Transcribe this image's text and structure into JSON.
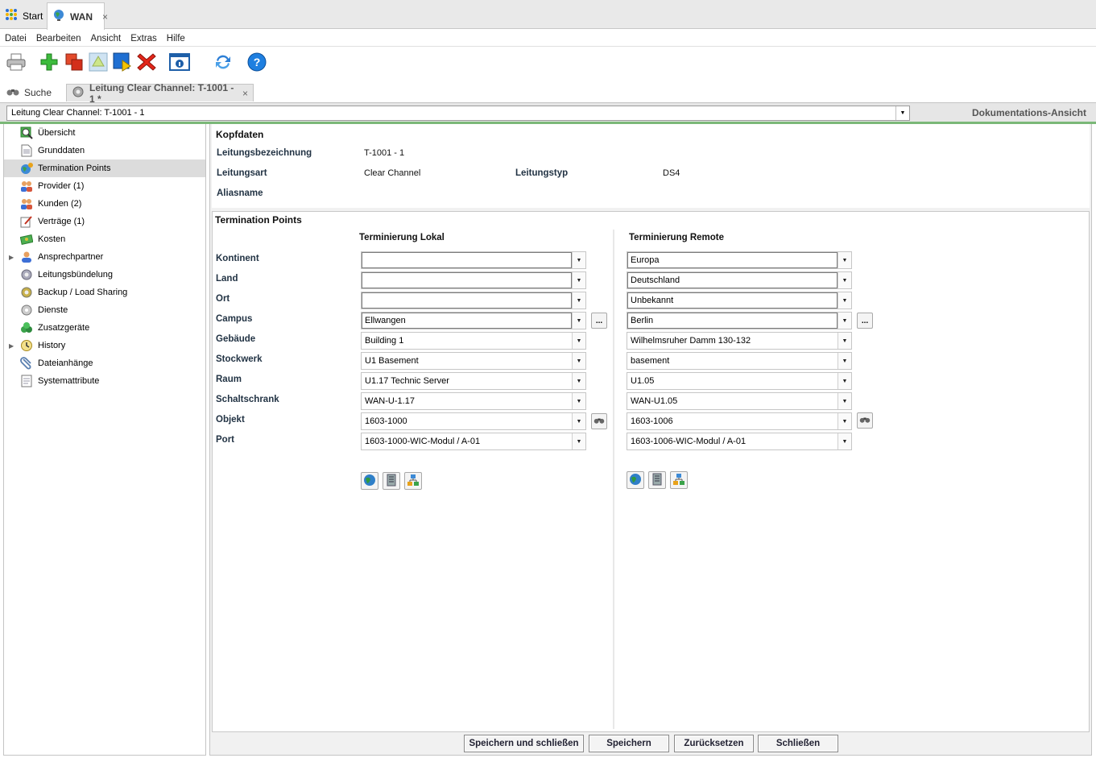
{
  "app_tabs": [
    {
      "label": "Start"
    },
    {
      "label": "WAN",
      "close": "×"
    }
  ],
  "menu": [
    "Datei",
    "Bearbeiten",
    "Ansicht",
    "Extras",
    "Hilfe"
  ],
  "toolbar": [
    {
      "icon": "printer-icon"
    },
    {
      "icon": "add-icon"
    },
    {
      "icon": "copy-icon"
    },
    {
      "icon": "move-up-icon"
    },
    {
      "icon": "export-icon"
    },
    {
      "icon": "delete-icon"
    },
    {
      "icon": "info-icon"
    },
    {
      "icon": "refresh-icon"
    },
    {
      "icon": "help-icon"
    }
  ],
  "doc_tabs": {
    "search_label": "Suche",
    "active_label": "Leitung Clear Channel: T-1001 - 1 *",
    "close": "×"
  },
  "header": {
    "combo_value": "Leitung Clear Channel: T-1001 - 1",
    "view_label": "Dokumentations-Ansicht"
  },
  "sidebar": {
    "items": [
      {
        "label": "Übersicht",
        "icon": "overview-icon"
      },
      {
        "label": "Grunddaten",
        "icon": "document-icon"
      },
      {
        "label": "Termination Points",
        "icon": "termination-icon",
        "selected": true
      },
      {
        "label": "Provider (1)",
        "icon": "people-icon"
      },
      {
        "label": "Kunden (2)",
        "icon": "people-icon"
      },
      {
        "label": "Verträge (1)",
        "icon": "contract-icon"
      },
      {
        "label": "Kosten",
        "icon": "money-icon"
      },
      {
        "label": "Ansprechpartner",
        "icon": "person-icon",
        "expandable": true
      },
      {
        "label": "Leitungsbündelung",
        "icon": "gear-icon"
      },
      {
        "label": "Backup / Load Sharing",
        "icon": "gear-icon"
      },
      {
        "label": "Dienste",
        "icon": "service-icon"
      },
      {
        "label": "Zusatzgeräte",
        "icon": "devices-icon"
      },
      {
        "label": "History",
        "icon": "history-icon",
        "expandable": true
      },
      {
        "label": "Dateianhänge",
        "icon": "attachment-icon"
      },
      {
        "label": "Systemattribute",
        "icon": "attributes-icon"
      }
    ]
  },
  "kopfdaten": {
    "title": "Kopfdaten",
    "leitungsbezeichnung_label": "Leitungsbezeichnung",
    "leitungsbezeichnung_value": "T-1001 - 1",
    "leitungsart_label": "Leitungsart",
    "leitungsart_value": "Clear Channel",
    "leitungstyp_label": "Leitungstyp",
    "leitungstyp_value": "DS4",
    "aliasname_label": "Aliasname"
  },
  "termination": {
    "title": "Termination Points",
    "local_header": "Terminierung Lokal",
    "remote_header": "Terminierung Remote",
    "browse_label": "...",
    "fields": [
      {
        "label": "Kontinent",
        "local": "",
        "remote": "Europa"
      },
      {
        "label": "Land",
        "local": "",
        "remote": "Deutschland"
      },
      {
        "label": "Ort",
        "local": "",
        "remote": "Unbekannt"
      },
      {
        "label": "Campus",
        "local": "Ellwangen",
        "remote": "Berlin"
      },
      {
        "label": "Gebäude",
        "local": "Building 1",
        "remote": "Wilhelmsruher Damm 130-132"
      },
      {
        "label": "Stockwerk",
        "local": "U1 Basement",
        "remote": "basement"
      },
      {
        "label": "Raum",
        "local": "U1.17 Technic Server",
        "remote": "U1.05"
      },
      {
        "label": "Schaltschrank",
        "local": "WAN-U-1.17",
        "remote": "WAN-U1.05"
      },
      {
        "label": "Objekt",
        "local": "1603-1000",
        "remote": "1603-1006"
      },
      {
        "label": "Port",
        "local": "1603-1000-WIC-Modul / A-01",
        "remote": "1603-1006-WIC-Modul / A-01"
      }
    ]
  },
  "buttons": {
    "save_close": "Speichern und schließen",
    "save": "Speichern",
    "reset": "Zurücksetzen",
    "close": "Schließen"
  }
}
